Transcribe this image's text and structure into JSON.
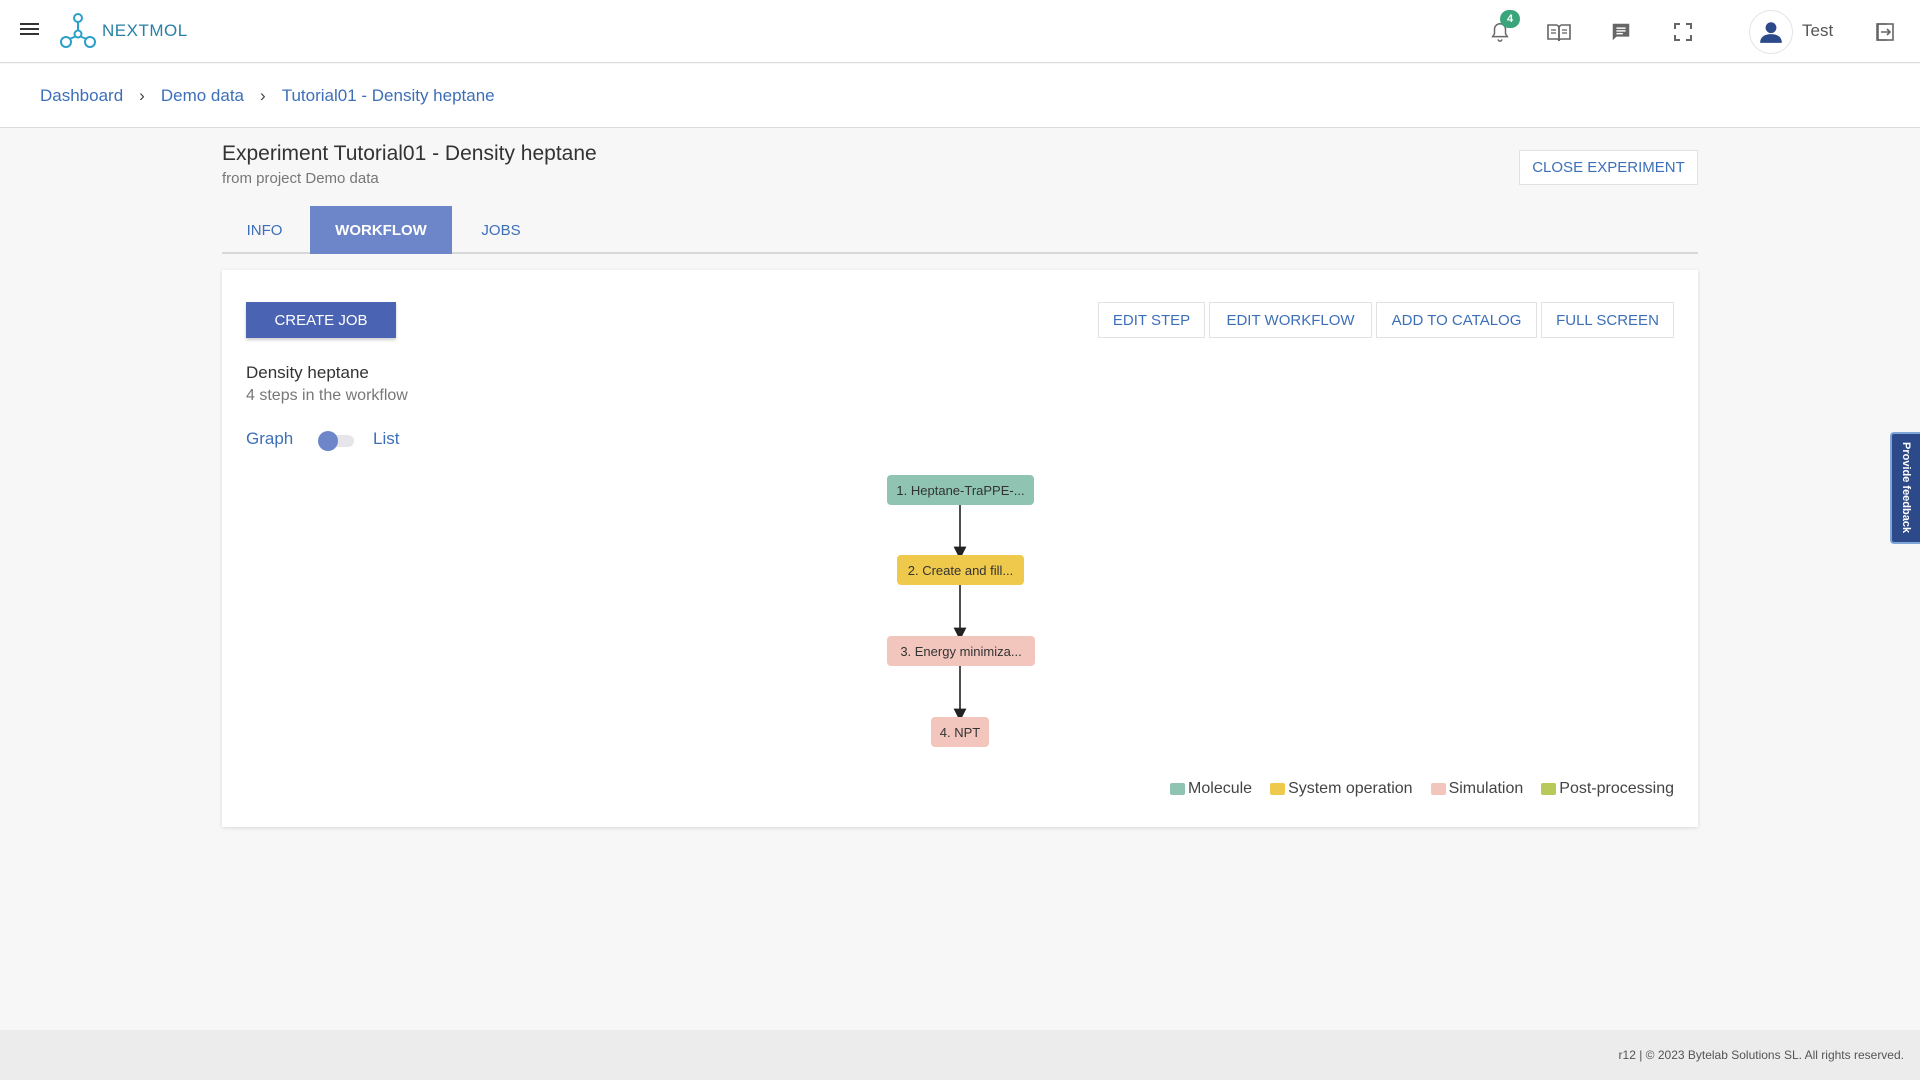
{
  "app": {
    "brand": "NEXTMOL"
  },
  "topbar": {
    "notifications_count": "4",
    "user_name": "Test"
  },
  "breadcrumb": {
    "items": [
      "Dashboard",
      "Demo data",
      "Tutorial01 - Density heptane"
    ],
    "separator": "›"
  },
  "experiment": {
    "title": "Experiment Tutorial01 - Density heptane",
    "subtitle": "from project Demo data",
    "close_label": "CLOSE EXPERIMENT"
  },
  "tabs": [
    {
      "label": "INFO",
      "active": false
    },
    {
      "label": "WORKFLOW",
      "active": true
    },
    {
      "label": "JOBS",
      "active": false
    }
  ],
  "workflow": {
    "create_job_label": "CREATE JOB",
    "actions": [
      "EDIT STEP",
      "EDIT WORKFLOW",
      "ADD TO CATALOG",
      "FULL SCREEN"
    ],
    "name": "Density heptane",
    "steps_summary": "4 steps in the workflow",
    "view_toggle": {
      "left": "Graph",
      "right": "List",
      "selected": "Graph"
    },
    "nodes": [
      {
        "label": "1. Heptane-TraPPE-...",
        "category": "Molecule"
      },
      {
        "label": "2. Create and fill...",
        "category": "System operation"
      },
      {
        "label": "3. Energy minimiza...",
        "category": "Simulation"
      },
      {
        "label": "4. NPT",
        "category": "Simulation"
      }
    ],
    "legend": [
      {
        "label": "Molecule",
        "color": "#8fc4b2"
      },
      {
        "label": "System operation",
        "color": "#efc94c"
      },
      {
        "label": "Simulation",
        "color": "#f3c6bd"
      },
      {
        "label": "Post-processing",
        "color": "#b8c95a"
      }
    ]
  },
  "feedback_label": "Provide feedback",
  "footer": {
    "text": "r12 | © 2023 Bytelab Solutions SL. All rights reserved."
  }
}
